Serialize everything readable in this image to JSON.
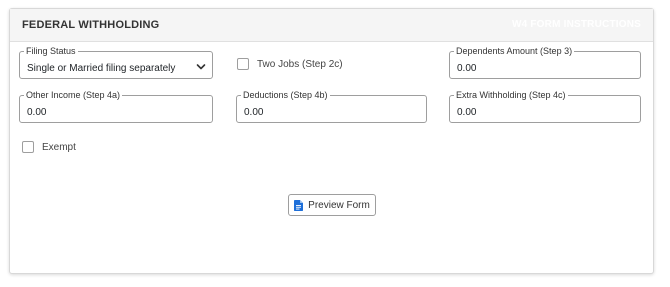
{
  "panel": {
    "title": "FEDERAL WITHHOLDING",
    "w4_link": "W4 FORM INSTRUCTIONS"
  },
  "fields": {
    "filing_status": {
      "label": "Filing Status",
      "value": "Single or Married filing separately"
    },
    "dependents": {
      "label": "Dependents Amount (Step 3)",
      "value": "0.00"
    },
    "other_income": {
      "label": "Other Income (Step 4a)",
      "value": "0.00"
    },
    "deductions": {
      "label": "Deductions (Step 4b)",
      "value": "0.00"
    },
    "extra_withholding": {
      "label": "Extra Withholding (Step 4c)",
      "value": "0.00"
    }
  },
  "checkboxes": {
    "two_jobs": {
      "label": "Two Jobs (Step 2c)",
      "checked": false
    },
    "exempt": {
      "label": "Exempt",
      "checked": false
    }
  },
  "actions": {
    "preview_label": "Preview Form",
    "preview_icon": "document-icon"
  },
  "colors": {
    "accent": "#1e6fd9",
    "header_bg": "#f5f5f5",
    "border": "#9e9e9e"
  }
}
